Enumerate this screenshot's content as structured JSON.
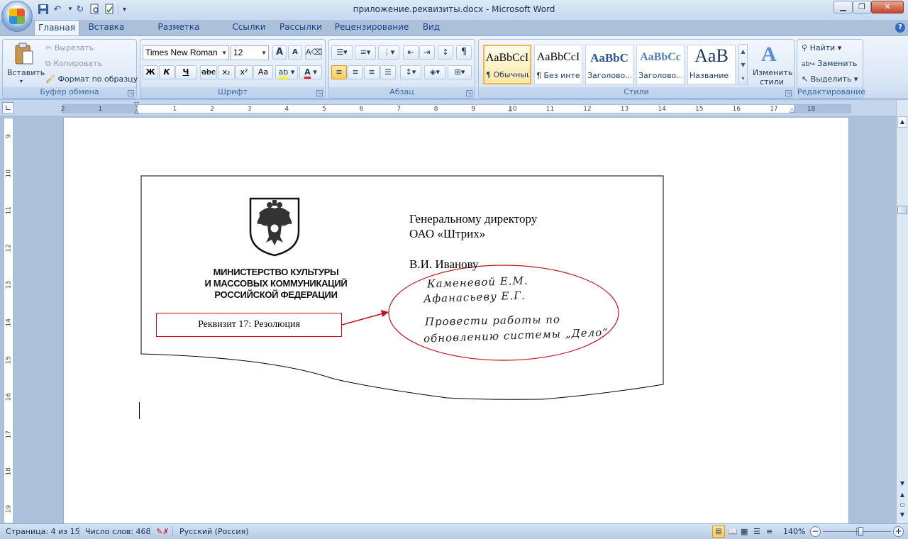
{
  "window": {
    "title": "приложение.реквизиты.docx - Microsoft Word",
    "buttons": [
      "minimize",
      "restore",
      "close"
    ]
  },
  "quick_access": [
    "save-icon",
    "undo-icon",
    "redo-icon",
    "print-preview-icon",
    "spelling-icon"
  ],
  "tabs": [
    "Главная",
    "Вставка",
    "Разметка страницы",
    "Ссылки",
    "Рассылки",
    "Рецензирование",
    "Вид"
  ],
  "active_tab": "Главная",
  "ribbon": {
    "clipboard": {
      "paste": "Вставить",
      "cut": "Вырезать",
      "copy": "Копировать",
      "format_painter": "Формат по образцу",
      "label": "Буфер обмена"
    },
    "font": {
      "family": "Times New Roman",
      "size": "12",
      "bold": "Ж",
      "italic": "К",
      "underline": "Ч",
      "strike": "abc",
      "subscript": "x₂",
      "superscript": "x²",
      "change_case": "Aa",
      "grow": "A",
      "shrink": "A",
      "label": "Шрифт",
      "highlight_color": "#ffff00",
      "font_color": "#e02020"
    },
    "paragraph": {
      "pilcrow": "¶",
      "label": "Абзац"
    },
    "styles": {
      "tiles": [
        {
          "preview": "AaBbCcI",
          "name": "¶ Обычный"
        },
        {
          "preview": "AaBbCcI",
          "name": "¶ Без инте..."
        },
        {
          "preview": "AaBbC",
          "name": "Заголово..."
        },
        {
          "preview": "AaBbCc",
          "name": "Заголово..."
        },
        {
          "preview": "AaB",
          "name": "Название"
        }
      ],
      "change_styles": "Изменить стили",
      "label": "Стили"
    },
    "editing": {
      "find": "Найти",
      "replace": "Заменить",
      "select": "Выделить",
      "label": "Редактирование"
    }
  },
  "ruler": {
    "h_ticks": [
      "2",
      "1",
      "1",
      "2",
      "3",
      "4",
      "5",
      "6",
      "7",
      "8",
      "9",
      "10",
      "11",
      "12",
      "13",
      "14",
      "15",
      "16",
      "17",
      "18"
    ],
    "v_ticks": [
      "9",
      "10",
      "11",
      "12",
      "13",
      "14",
      "15",
      "16",
      "17",
      "18",
      "19"
    ]
  },
  "document": {
    "emblem_lines": [
      "МИНИСТЕРСТВО КУЛЬТУРЫ",
      "И МАССОВЫХ КОММУНИКАЦИЙ",
      "РОССИЙСКОЙ ФЕДЕРАЦИИ"
    ],
    "addressee": [
      "Генеральному директору",
      "ОАО «Штрих»",
      "В.И. Иванову"
    ],
    "callout": "Реквизит  17: Резолюция",
    "resolution_lines": [
      "Каменевой  Е.М.",
      "Афанасьеву  Е.Г.",
      "Провести  работы  по",
      "обновлению  системы  „Дело“"
    ],
    "accent_color": "#c0141c"
  },
  "status": {
    "page": "Страница: 4 из 15",
    "words": "Число слов: 468",
    "language": "Русский (Россия)",
    "zoom": "140%",
    "zoom_level_fraction": 0.55
  }
}
